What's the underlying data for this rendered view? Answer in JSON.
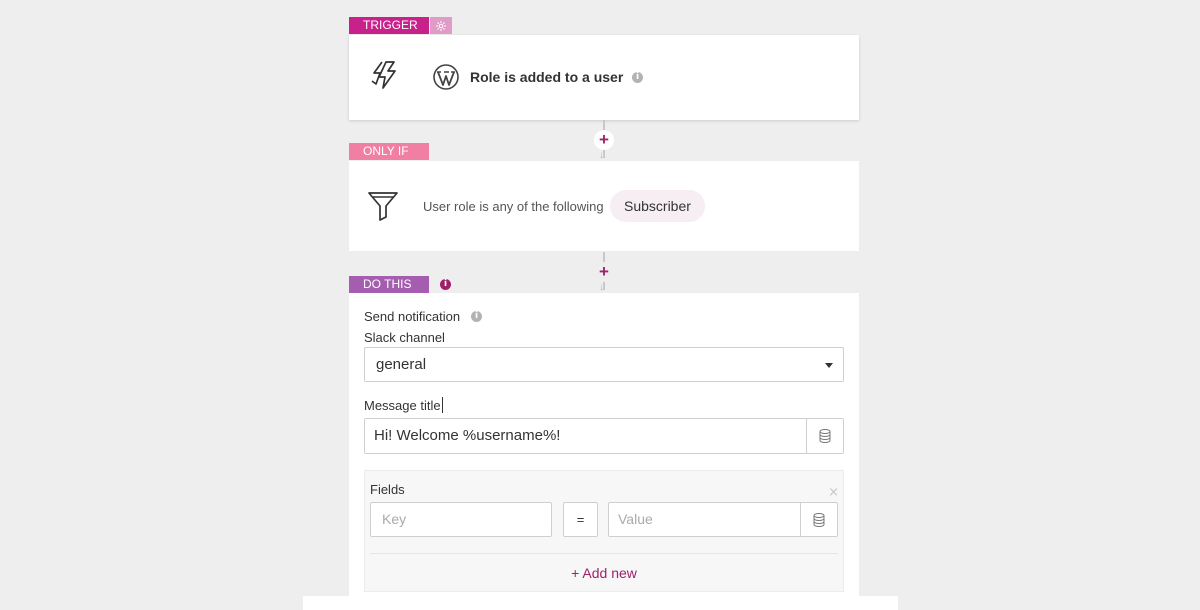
{
  "trigger": {
    "badge": "TRIGGER",
    "title": "Role is added to a user",
    "info_icon": "i"
  },
  "condition": {
    "badge": "ONLY IF",
    "text": "User role is any of the following",
    "chip": "Subscriber"
  },
  "action": {
    "badge": "DO THIS",
    "info_icon": "i",
    "title": "Send notification",
    "channel_label": "Slack channel",
    "channel_value": "general",
    "message_label": "Message title",
    "message_value": "Hi! Welcome %username%!",
    "fields": {
      "label": "Fields",
      "key_placeholder": "Key",
      "equals": "=",
      "value_placeholder": "Value",
      "add_new": "+ Add new",
      "remove": "×"
    }
  },
  "connector": {
    "plus": "+",
    "arrow": "↓"
  },
  "colors": {
    "trigger": "#c8218c",
    "condition": "#f17fa3",
    "action": "#a55db0",
    "accent": "#a0216a"
  }
}
